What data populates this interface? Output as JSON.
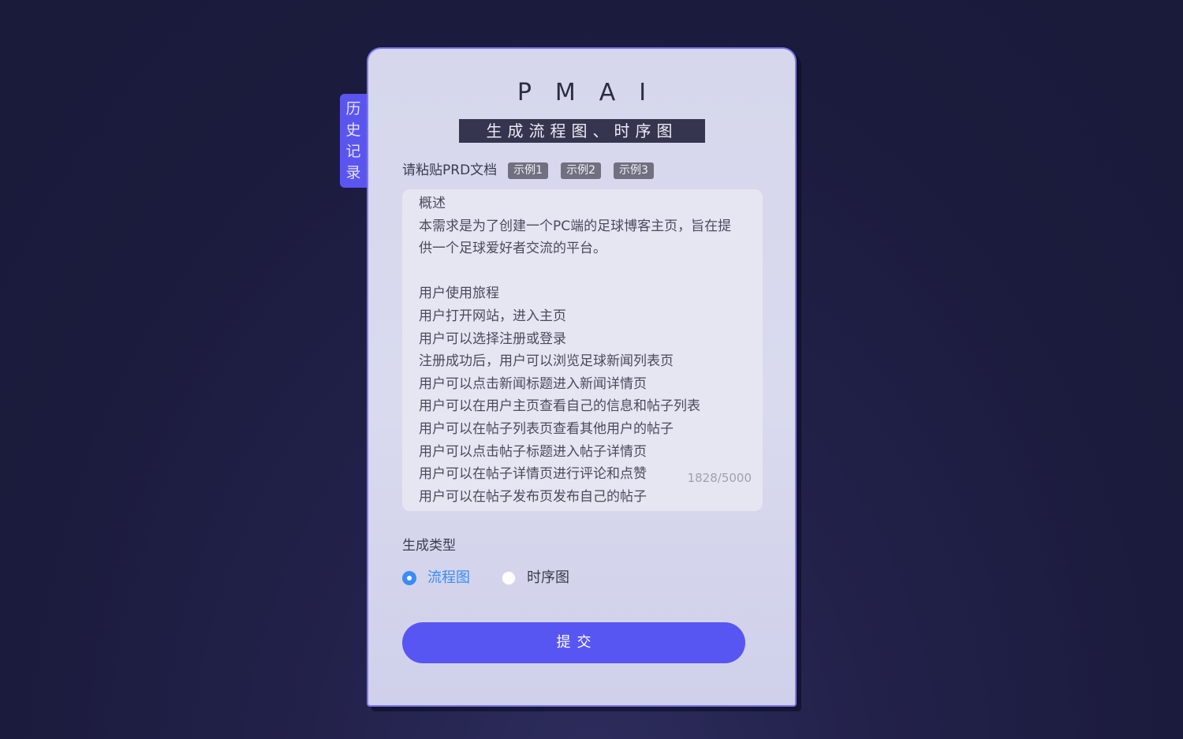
{
  "history_tab": {
    "chars": [
      "历",
      "史",
      "记",
      "录"
    ]
  },
  "header": {
    "logo": "PMAI",
    "subtitle": "生成流程图、时序图"
  },
  "prd": {
    "label": "请粘贴PRD文档",
    "examples": [
      "示例1",
      "示例2",
      "示例3"
    ],
    "content": "概述\n本需求是为了创建一个PC端的足球博客主页，旨在提供一个足球爱好者交流的平台。\n\n用户使用旅程\n用户打开网站，进入主页\n用户可以选择注册或登录\n注册成功后，用户可以浏览足球新闻列表页\n用户可以点击新闻标题进入新闻详情页\n用户可以在用户主页查看自己的信息和帖子列表\n用户可以在帖子列表页查看其他用户的帖子\n用户可以点击帖子标题进入帖子详情页\n用户可以在帖子详情页进行评论和点赞\n用户可以在帖子发布页发布自己的帖子",
    "char_count": "1828/5000"
  },
  "generate_type": {
    "label": "生成类型",
    "options": [
      {
        "label": "流程图",
        "selected": true
      },
      {
        "label": "时序图",
        "selected": false
      }
    ]
  },
  "submit": {
    "label": "提交"
  },
  "colors": {
    "accent": "#5856f2",
    "radio_active": "#3b8cf5",
    "subtitle_bg": "#35354f",
    "background": "#1b1b3d"
  }
}
